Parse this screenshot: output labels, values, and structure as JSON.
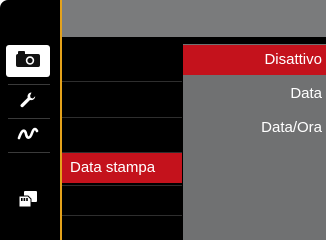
{
  "sidebar": {
    "tabs": [
      {
        "icon": "camera-icon",
        "active": true
      },
      {
        "icon": "wrench-icon",
        "active": false
      },
      {
        "icon": "squiggle-icon",
        "active": false
      },
      {
        "icon": "sd-card-icon",
        "active": false
      }
    ]
  },
  "menu": {
    "selected_item_label": "Data stampa"
  },
  "submenu": {
    "options": [
      {
        "label": "Disattivo",
        "selected": true
      },
      {
        "label": "Data",
        "selected": false
      },
      {
        "label": "Data/Ora",
        "selected": false
      }
    ]
  },
  "colors": {
    "accent_red": "#c4121c",
    "divider_orange": "#e4a21b",
    "panel_gray": "#707172"
  }
}
